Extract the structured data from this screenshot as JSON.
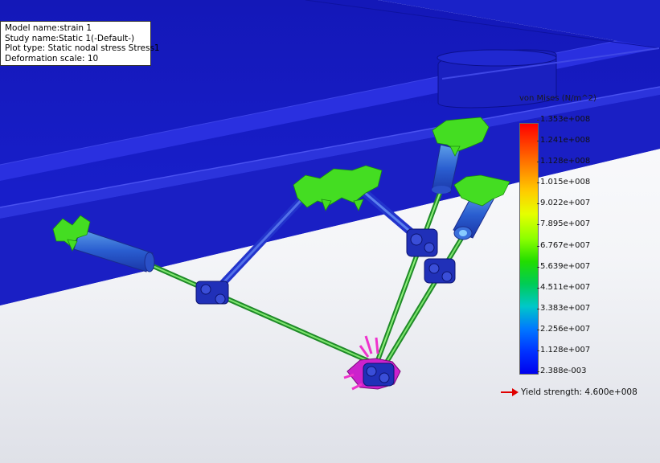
{
  "info": {
    "model_name": "Model name:strain 1",
    "study_name": "Study name:Static 1(-Default-)",
    "plot_type": "Plot type: Static nodal stress Stress1",
    "deformation_scale": "Deformation scale: 10"
  },
  "legend": {
    "title": "von Mises (N/m^2)",
    "ticks": [
      "1.353e+008",
      "1.241e+008",
      "1.128e+008",
      "1.015e+008",
      "9.022e+007",
      "7.895e+007",
      "6.767e+007",
      "5.639e+007",
      "4.511e+007",
      "3.383e+007",
      "2.256e+007",
      "1.128e+007",
      "2.388e-003"
    ],
    "yield_label": "Yield strength: 4.600e+008",
    "colors": {
      "max": "#ff0000",
      "mid": "#22dd00",
      "min": "#0000ee",
      "yield_arrow": "#e00000"
    }
  },
  "model": {
    "frame_color": "#1a20c8",
    "rod_color": "#3ec83e",
    "link_color": "#2233cc",
    "fixture_color": "#44dd22",
    "load_color": "#cc22cc"
  }
}
